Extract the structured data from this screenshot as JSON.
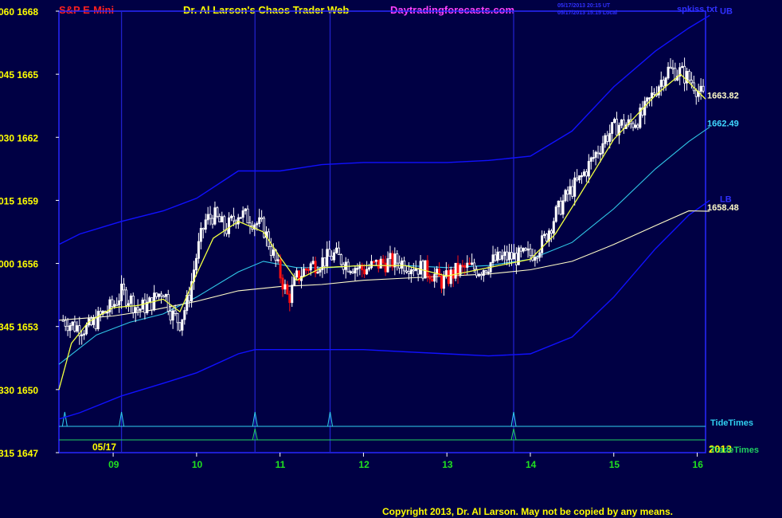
{
  "header": {
    "symbol": "S&P E-Mini",
    "title": "Dr. Al Larson's Chaos Trader Web",
    "site": "Daytradingforecasts.com",
    "stamp_line1": "05/17/2013 20:15 UT",
    "stamp_line2": "05/17/2013 15:15 Local",
    "file": "spkiss.txt"
  },
  "footer": {
    "copyright": "Copyright 2013, Dr. Al Larson. May not be copied by any means."
  },
  "chart_data": {
    "type": "candlestick",
    "ylim": [
      1647,
      1668
    ],
    "xlim": [
      8.35,
      16.1
    ],
    "y_ticks": [
      {
        "value": 1668,
        "label": "060  1668"
      },
      {
        "value": 1665,
        "label": "045  1665"
      },
      {
        "value": 1662,
        "label": "030  1662"
      },
      {
        "value": 1659,
        "label": "015  1659"
      },
      {
        "value": 1656,
        "label": "000  1656"
      },
      {
        "value": 1653,
        "label": "345  1653"
      },
      {
        "value": 1650,
        "label": "330  1650"
      },
      {
        "value": 1647,
        "label": "315  1647"
      }
    ],
    "x_ticks": [
      {
        "value": 9,
        "label": "09"
      },
      {
        "value": 10,
        "label": "10"
      },
      {
        "value": 11,
        "label": "11"
      },
      {
        "value": 12,
        "label": "12"
      },
      {
        "value": 13,
        "label": "13"
      },
      {
        "value": 14,
        "label": "14"
      },
      {
        "value": 15,
        "label": "15"
      },
      {
        "value": 16,
        "label": "16"
      }
    ],
    "start_date_label": "05/17",
    "year_label": "2013",
    "vertical_lines": [
      9.1,
      10.7,
      11.6,
      13.8
    ],
    "price_path": [
      [
        8.4,
        1653.3
      ],
      [
        8.55,
        1653.0
      ],
      [
        8.7,
        1652.9
      ],
      [
        8.85,
        1653.5
      ],
      [
        9.0,
        1654.0
      ],
      [
        9.1,
        1654.6
      ],
      [
        9.2,
        1654.3
      ],
      [
        9.3,
        1653.8
      ],
      [
        9.45,
        1654.1
      ],
      [
        9.6,
        1654.8
      ],
      [
        9.7,
        1653.6
      ],
      [
        9.8,
        1653.2
      ],
      [
        9.9,
        1654.3
      ],
      [
        10.0,
        1656.4
      ],
      [
        10.1,
        1658.0
      ],
      [
        10.2,
        1658.3
      ],
      [
        10.35,
        1657.6
      ],
      [
        10.5,
        1658.4
      ],
      [
        10.65,
        1658.1
      ],
      [
        10.8,
        1657.7
      ],
      [
        10.9,
        1656.6
      ],
      [
        11.0,
        1655.5
      ],
      [
        11.1,
        1654.3
      ],
      [
        11.2,
        1655.3
      ],
      [
        11.35,
        1655.9
      ],
      [
        11.5,
        1656.1
      ],
      [
        11.65,
        1656.4
      ],
      [
        11.8,
        1656.0
      ],
      [
        12.0,
        1655.7
      ],
      [
        12.2,
        1656.0
      ],
      [
        12.4,
        1656.1
      ],
      [
        12.6,
        1655.9
      ],
      [
        12.8,
        1655.6
      ],
      [
        12.95,
        1655.1
      ],
      [
        13.1,
        1655.6
      ],
      [
        13.25,
        1655.8
      ],
      [
        13.4,
        1655.7
      ],
      [
        13.55,
        1656.1
      ],
      [
        13.7,
        1656.3
      ],
      [
        13.85,
        1656.3
      ],
      [
        14.0,
        1656.4
      ],
      [
        14.15,
        1657.0
      ],
      [
        14.3,
        1658.3
      ],
      [
        14.45,
        1659.3
      ],
      [
        14.6,
        1660.0
      ],
      [
        14.75,
        1661.0
      ],
      [
        14.9,
        1662.0
      ],
      [
        15.05,
        1662.6
      ],
      [
        15.2,
        1662.6
      ],
      [
        15.35,
        1663.1
      ],
      [
        15.5,
        1664.3
      ],
      [
        15.65,
        1665.2
      ],
      [
        15.8,
        1665.1
      ],
      [
        15.95,
        1664.6
      ],
      [
        16.05,
        1664.0
      ],
      [
        16.1,
        1663.82
      ]
    ],
    "series": [
      {
        "name": "UB",
        "color": "#1010ff",
        "points": [
          [
            8.35,
            1656.9
          ],
          [
            8.6,
            1657.4
          ],
          [
            9.1,
            1658.0
          ],
          [
            9.6,
            1658.5
          ],
          [
            10.0,
            1659.1
          ],
          [
            10.5,
            1660.4
          ],
          [
            11.0,
            1660.4
          ],
          [
            11.5,
            1660.7
          ],
          [
            12.0,
            1660.8
          ],
          [
            12.5,
            1660.8
          ],
          [
            13.0,
            1660.8
          ],
          [
            13.5,
            1660.9
          ],
          [
            14.0,
            1661.1
          ],
          [
            14.5,
            1662.3
          ],
          [
            15.0,
            1664.4
          ],
          [
            15.5,
            1666.1
          ],
          [
            15.9,
            1667.2
          ],
          [
            16.15,
            1667.8
          ]
        ],
        "end_label": "UB"
      },
      {
        "name": "LB",
        "color": "#1010ff",
        "points": [
          [
            8.35,
            1648.6
          ],
          [
            8.6,
            1648.9
          ],
          [
            9.1,
            1649.7
          ],
          [
            9.6,
            1650.3
          ],
          [
            10.0,
            1650.8
          ],
          [
            10.5,
            1651.7
          ],
          [
            10.7,
            1651.9
          ],
          [
            11.0,
            1651.9
          ],
          [
            11.5,
            1651.9
          ],
          [
            12.0,
            1651.9
          ],
          [
            12.5,
            1651.8
          ],
          [
            13.0,
            1651.7
          ],
          [
            13.5,
            1651.6
          ],
          [
            14.0,
            1651.7
          ],
          [
            14.5,
            1652.5
          ],
          [
            15.0,
            1654.4
          ],
          [
            15.5,
            1656.7
          ],
          [
            15.9,
            1658.3
          ],
          [
            16.15,
            1659.0
          ]
        ],
        "end_label": "LB"
      },
      {
        "name": "cyan",
        "color": "#30c8e8",
        "points": [
          [
            8.35,
            1651.2
          ],
          [
            8.8,
            1652.6
          ],
          [
            9.2,
            1653.2
          ],
          [
            9.6,
            1653.6
          ],
          [
            10.0,
            1654.4
          ],
          [
            10.5,
            1655.6
          ],
          [
            10.8,
            1656.1
          ],
          [
            11.2,
            1655.8
          ],
          [
            11.6,
            1655.8
          ],
          [
            12.0,
            1655.9
          ],
          [
            12.5,
            1655.9
          ],
          [
            13.0,
            1655.8
          ],
          [
            13.5,
            1655.9
          ],
          [
            14.0,
            1656.2
          ],
          [
            14.5,
            1657.0
          ],
          [
            15.0,
            1658.6
          ],
          [
            15.5,
            1660.5
          ],
          [
            15.9,
            1661.8
          ],
          [
            16.15,
            1662.49
          ]
        ],
        "end_value": "1662.49"
      },
      {
        "name": "white",
        "color": "#fffcc8",
        "points": [
          [
            8.35,
            1653.3
          ],
          [
            9.0,
            1653.5
          ],
          [
            9.5,
            1653.8
          ],
          [
            10.0,
            1654.2
          ],
          [
            10.5,
            1654.7
          ],
          [
            11.0,
            1654.9
          ],
          [
            11.5,
            1655.0
          ],
          [
            12.0,
            1655.2
          ],
          [
            12.5,
            1655.3
          ],
          [
            13.0,
            1655.4
          ],
          [
            13.5,
            1655.5
          ],
          [
            14.0,
            1655.7
          ],
          [
            14.5,
            1656.1
          ],
          [
            15.0,
            1656.9
          ],
          [
            15.5,
            1657.8
          ],
          [
            15.9,
            1658.5
          ],
          [
            16.15,
            1658.48
          ]
        ],
        "end_value": "1658.48"
      },
      {
        "name": "yellow",
        "color": "#f0ff40",
        "points": [
          [
            8.35,
            1650.0
          ],
          [
            8.5,
            1652.2
          ],
          [
            8.7,
            1653.2
          ],
          [
            9.0,
            1653.9
          ],
          [
            9.3,
            1654.0
          ],
          [
            9.6,
            1654.3
          ],
          [
            9.8,
            1653.7
          ],
          [
            10.0,
            1655.5
          ],
          [
            10.2,
            1657.2
          ],
          [
            10.5,
            1658.0
          ],
          [
            10.8,
            1657.5
          ],
          [
            11.0,
            1656.3
          ],
          [
            11.2,
            1655.2
          ],
          [
            11.5,
            1655.8
          ],
          [
            12.0,
            1655.9
          ],
          [
            12.5,
            1655.9
          ],
          [
            13.0,
            1655.4
          ],
          [
            13.5,
            1655.8
          ],
          [
            14.0,
            1656.2
          ],
          [
            14.3,
            1657.4
          ],
          [
            14.6,
            1659.3
          ],
          [
            15.0,
            1661.9
          ],
          [
            15.5,
            1664.0
          ],
          [
            15.8,
            1665.0
          ],
          [
            16.1,
            1663.82
          ]
        ],
        "end_value": "1663.82"
      }
    ],
    "tide_times": {
      "label": "TideTimes",
      "color": "#30d0f0",
      "spikes": [
        8.42,
        9.1,
        10.7,
        11.6,
        13.8
      ]
    },
    "trade_times": {
      "label": "TradeTimes",
      "color": "#20d060",
      "spikes": [
        10.7,
        13.8
      ]
    }
  }
}
